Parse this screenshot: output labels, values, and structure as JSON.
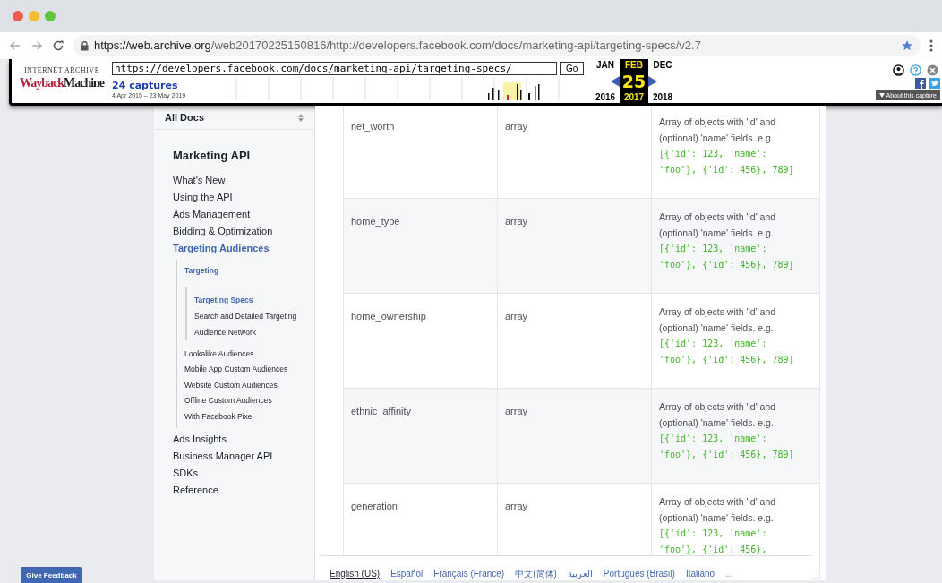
{
  "browser": {
    "url_host": "https://web.archive.org",
    "url_path": "/web20170225150816/http://developers.facebook.com/docs/marketing-api/targeting-specs/v2.7"
  },
  "wayback": {
    "logo_top": "INTERNET ARCHIVE",
    "logo_main_1": "Wayback",
    "logo_main_2": "Machine",
    "url": "https://developers.facebook.com/docs/marketing-api/targeting-specs/",
    "go": "Go",
    "captures": "24 captures",
    "range": "4 Apr 2015 – 23 May 2019",
    "about": "About this capture",
    "months": [
      {
        "label": "JAN",
        "year": "2016",
        "selected": false
      },
      {
        "label": "FEB",
        "day": "25",
        "year": "2017",
        "selected": true
      },
      {
        "label": "DEC",
        "year": "2018",
        "selected": false
      }
    ]
  },
  "sidebar": {
    "select": "All Docs",
    "title": "Marketing API",
    "items": [
      {
        "label": "What's New",
        "selected": false
      },
      {
        "label": "Using the API",
        "selected": false
      },
      {
        "label": "Ads Management",
        "selected": false
      },
      {
        "label": "Bidding & Optimization",
        "selected": false
      },
      {
        "label": "Targeting Audiences",
        "selected": true,
        "children": [
          {
            "label": "Targeting",
            "selected": true,
            "children": [
              {
                "label": "Targeting Specs",
                "selected": true
              },
              {
                "label": "Search and Detailed Targeting",
                "selected": false
              },
              {
                "label": "Audience Network",
                "selected": false
              }
            ]
          },
          {
            "label": "Lookalike Audiences",
            "selected": false
          },
          {
            "label": "Mobile App Custom Audiences",
            "selected": false
          },
          {
            "label": "Website Custom Audiences",
            "selected": false
          },
          {
            "label": "Offline Custom Audiences",
            "selected": false
          },
          {
            "label": "With Facebook Pixel",
            "selected": false
          }
        ]
      },
      {
        "label": "Ads Insights",
        "selected": false
      },
      {
        "label": "Business Manager API",
        "selected": false
      },
      {
        "label": "SDKs",
        "selected": false
      },
      {
        "label": "Reference",
        "selected": false
      }
    ]
  },
  "table": {
    "rows": [
      {
        "name": "net_worth",
        "type": "array",
        "description": "Array of objects with 'id' and (optional) 'name' fields. e.g.",
        "code": "[{'id': 123, 'name': 'foo'}, {'id': 456}, 789]"
      },
      {
        "name": "home_type",
        "type": "array",
        "description": "Array of objects with 'id' and (optional) 'name' fields. e.g.",
        "code": "[{'id': 123, 'name': 'foo'}, {'id': 456}, 789]"
      },
      {
        "name": "home_ownership",
        "type": "array",
        "description": "Array of objects with 'id' and (optional) 'name' fields. e.g.",
        "code": "[{'id': 123, 'name': 'foo'}, {'id': 456}, 789]"
      },
      {
        "name": "ethnic_affinity",
        "type": "array",
        "description": "Array of objects with 'id' and (optional) 'name' fields. e.g.",
        "code": "[{'id': 123, 'name': 'foo'}, {'id': 456}, 789]"
      },
      {
        "name": "generation",
        "type": "array",
        "description": "Array of objects with 'id' and (optional) 'name' fields. e.g.",
        "code": "[{'id': 123, 'name': 'foo'}, {'id': 456},"
      }
    ]
  },
  "languages": [
    {
      "label": "English (US)",
      "selected": true
    },
    {
      "label": "Español",
      "selected": false
    },
    {
      "label": "Français (France)",
      "selected": false
    },
    {
      "label": "中文(简体)",
      "selected": false
    },
    {
      "label": "العربية",
      "selected": false
    },
    {
      "label": "Português (Brasil)",
      "selected": false
    },
    {
      "label": "Italiano",
      "selected": false
    }
  ],
  "languages_more": "...",
  "feedback_button": "Give Feedback"
}
